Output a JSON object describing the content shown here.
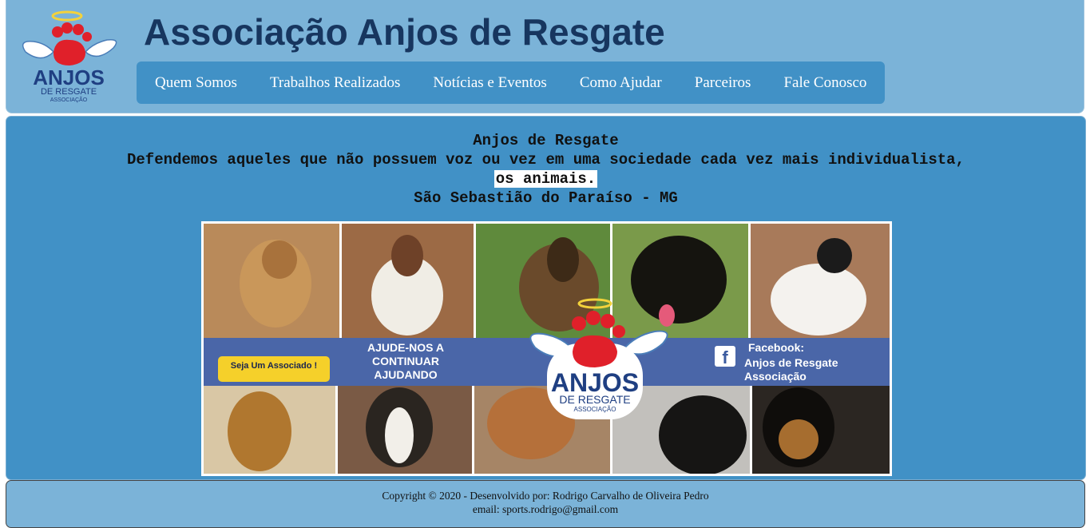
{
  "header": {
    "title": "Associação Anjos de Resgate",
    "logo": {
      "line1": "ANJOS",
      "line2": "DE RESGATE",
      "line3": "ASSOCIAÇÃO"
    }
  },
  "nav": {
    "items": [
      {
        "label": "Quem Somos"
      },
      {
        "label": "Trabalhos Realizados"
      },
      {
        "label": "Notícias e Eventos"
      },
      {
        "label": "Como Ajudar"
      },
      {
        "label": "Parceiros"
      },
      {
        "label": "Fale Conosco"
      }
    ]
  },
  "main": {
    "heading": "Anjos de Resgate",
    "tagline": "Defendemos aqueles que não possuem voz ou vez em uma sociedade cada vez mais individualista,",
    "tagline_highlight": "os animais.",
    "location": "São Sebastião do Paraíso - MG"
  },
  "banner": {
    "associate_badge": "Seja Um Associado !",
    "help_text_1": "AJUDE-NOS A",
    "help_text_2": "CONTINUAR",
    "help_text_3": "AJUDANDO",
    "facebook_label": "Facebook:",
    "facebook_name_1": "Anjos de Resgate",
    "facebook_name_2": "Associação",
    "logo_line1": "ANJOS",
    "logo_line2": "DE RESGATE",
    "logo_line3": "ASSOCIAÇÃO"
  },
  "footer": {
    "copyright": "Copyright © 2020 - Desenvolvido por: Rodrigo Carvalho de Oliveira Pedro",
    "email": "email: sports.rodrigo@gmail.com"
  },
  "colors": {
    "header_bg": "#7bb3d8",
    "nav_bg": "#4191c6",
    "main_bg": "#4191c6",
    "title": "#17365f",
    "paw_red": "#e0202a",
    "banner_band": "#4a66a8"
  }
}
